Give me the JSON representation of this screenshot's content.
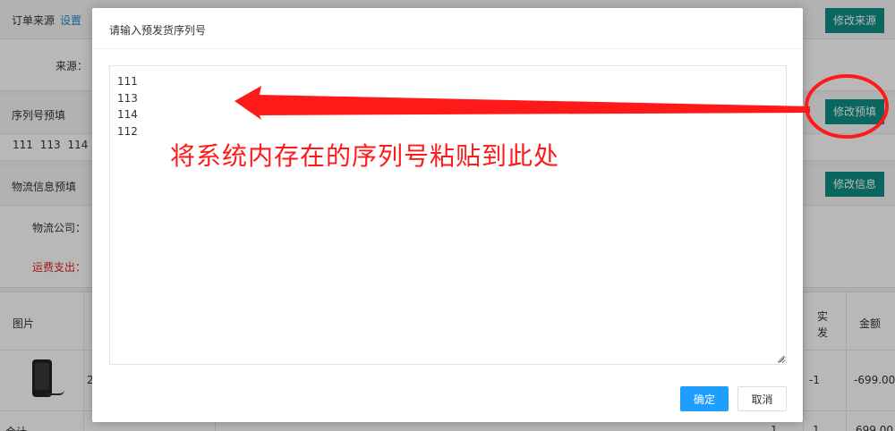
{
  "background": {
    "order_source": {
      "title": "订单来源",
      "link": "设置",
      "button": "修改来源",
      "label": "来源："
    },
    "serial_preset": {
      "title": "序列号预填",
      "button": "修改预填",
      "values": "111 113 114"
    },
    "logistics": {
      "title": "物流信息预填",
      "button": "修改信息",
      "company_label": "物流公司：",
      "fee_label": "运费支出："
    },
    "table": {
      "headers": {
        "image": "图片",
        "shipped": "实发",
        "amount": "金额"
      },
      "rows": [
        {
          "code": "2",
          "shipped": "-1",
          "amount": "-699.00"
        }
      ],
      "footer": {
        "label": "合计",
        "qty": "1",
        "shipped": "1",
        "amount": "699.00"
      }
    }
  },
  "dialog": {
    "title": "请输入预发货序列号",
    "serial_text": "111\n113\n114\n112",
    "ok_label": "确定",
    "cancel_label": "取消"
  },
  "annotation": {
    "text": "将系统内存在的序列号粘贴到此处",
    "color": "#ff1a1a"
  },
  "colors": {
    "teal": "#0f8f86",
    "primary": "#1e9fff",
    "link": "#1e88c7",
    "warning_text": "#e02020"
  }
}
